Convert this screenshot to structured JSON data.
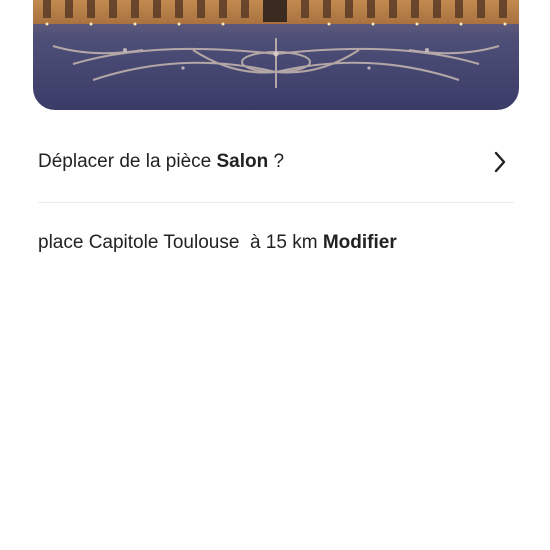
{
  "hero_image": {
    "icon": "capitole-square-photo"
  },
  "move_prompt": {
    "prefix": "Déplacer de la pièce ",
    "room": "Salon",
    "suffix": " ?",
    "icon": "chevron-right-icon"
  },
  "location": {
    "place": "place Capitole Toulouse",
    "distance": "  à 15 km ",
    "modify_label": "Modifier"
  }
}
